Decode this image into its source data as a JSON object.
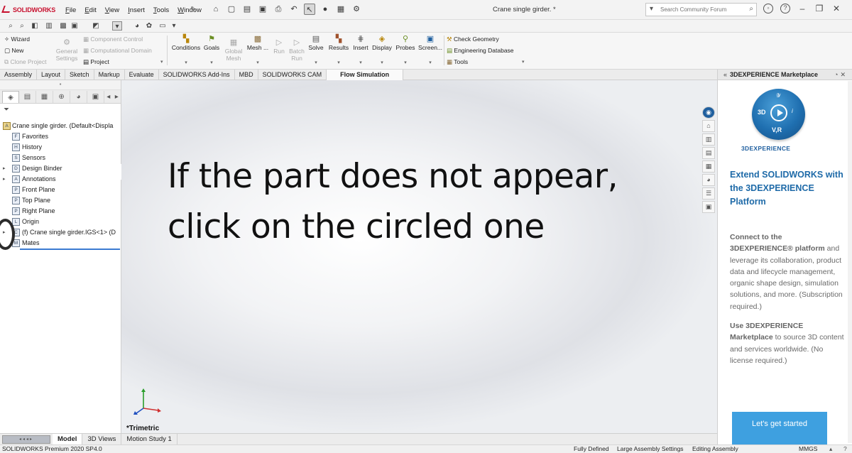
{
  "app": {
    "logo": "SOLIDWORKS",
    "document_title": "Crane single girder. *"
  },
  "menu": [
    "File",
    "Edit",
    "View",
    "Insert",
    "Tools",
    "Window"
  ],
  "search": {
    "placeholder": "Search Community Forum"
  },
  "ribbon": {
    "wizard": "Wizard",
    "new": "New",
    "clone_project": "Clone Project",
    "general_settings": "General Settings",
    "component_control": "Component Control",
    "computational_domain": "Computational Domain",
    "project": "Project",
    "conditions": "Conditions",
    "goals": "Goals",
    "global_mesh": "Global Mesh",
    "mesh": "Mesh ...",
    "run": "Run",
    "batch_run": "Batch Run",
    "solve": "Solve",
    "results": "Results",
    "insert": "Insert",
    "display": "Display",
    "probes": "Probes",
    "screen": "Screen...",
    "check_geometry": "Check Geometry",
    "engineering_database": "Engineering Database",
    "tools": "Tools"
  },
  "tabs": [
    "Assembly",
    "Layout",
    "Sketch",
    "Markup",
    "Evaluate",
    "SOLIDWORKS Add-Ins",
    "MBD",
    "SOLIDWORKS CAM",
    "Flow Simulation"
  ],
  "active_tab": "Flow Simulation",
  "tree": {
    "root": "Crane single girder.  (Default<Displa",
    "items": [
      {
        "label": "Favorites",
        "icon": "F"
      },
      {
        "label": "History",
        "icon": "H"
      },
      {
        "label": "Sensors",
        "icon": "S"
      },
      {
        "label": "Design Binder",
        "icon": "D",
        "expand": true
      },
      {
        "label": "Annotations",
        "icon": "A",
        "expand": true
      },
      {
        "label": "Front Plane",
        "icon": "P"
      },
      {
        "label": "Top Plane",
        "icon": "P"
      },
      {
        "label": "Right Plane",
        "icon": "P"
      },
      {
        "label": "Origin",
        "icon": "L"
      },
      {
        "label": "(f) Crane single girder.IGS<1> (D",
        "icon": "C",
        "expand": true
      },
      {
        "label": "Mates",
        "icon": "M"
      }
    ]
  },
  "overlay": {
    "line1": "If the part does not appear,",
    "line2": "click on the circled one"
  },
  "view_name": "*Trimetric",
  "taskpane": {
    "title": "3DEXPERIENCE Marketplace",
    "brand": "3DEXPERIENCE",
    "compass": {
      "left": "3D",
      "bottom": "V,R"
    },
    "heading": "Extend SOLIDWORKS with the 3DEXPERIENCE Platform",
    "p1_a": "Connect to the 3DEXPERIENCE® platform",
    "p1_b": " and leverage its collaboration, product data and lifecycle management, organic shape design, simulation solutions, and more. (Subscription required.)",
    "p2_a": "Use 3DEXPERIENCE Marketplace",
    "p2_b": " to source 3D content and services worldwide. (No license required.)",
    "cta": "Let's get started"
  },
  "bottom_tabs": [
    "Model",
    "3D Views",
    "Motion Study 1"
  ],
  "active_bottom_tab": "Model",
  "status": {
    "product": "SOLIDWORKS Premium 2020 SP4.0",
    "defined": "Fully Defined",
    "large_assembly": "Large Assembly Settings",
    "editing": "Editing Assembly",
    "units": "MMGS"
  },
  "colors": {
    "brand_red": "#c8102e",
    "heading_blue": "#1e6aa8",
    "cta_blue": "#3ea0e0",
    "selection_blue": "#3b7bd2"
  }
}
